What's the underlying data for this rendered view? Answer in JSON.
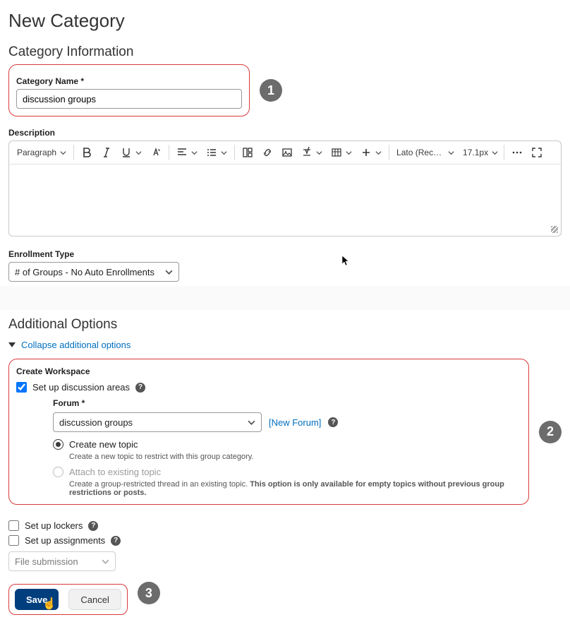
{
  "page": {
    "title": "New Category",
    "section_category_info": "Category Information",
    "section_additional": "Additional Options"
  },
  "category_name": {
    "label": "Category Name *",
    "value": "discussion groups"
  },
  "description": {
    "label": "Description"
  },
  "editor": {
    "paragraph_label": "Paragraph",
    "font_label": "Lato (Recom…",
    "size_label": "17.1px"
  },
  "enrollment": {
    "label": "Enrollment Type",
    "value": "# of Groups - No Auto Enrollments"
  },
  "collapse_link": "Collapse additional options",
  "workspace": {
    "label": "Create Workspace",
    "discussion_checkbox": "Set up discussion areas",
    "forum_label": "Forum *",
    "forum_value": "discussion groups",
    "new_forum_link": "[New Forum]",
    "radio1": {
      "label": "Create new topic",
      "desc": "Create a new topic to restrict with this group category."
    },
    "radio2": {
      "label": "Attach to existing topic",
      "desc1": "Create a group-restricted thread in an existing topic. ",
      "desc2": "This option is only available for empty topics without previous group restrictions or posts."
    }
  },
  "lockers_checkbox": "Set up lockers",
  "assignments_checkbox": "Set up assignments",
  "file_submission": "File submission",
  "buttons": {
    "save": "Save",
    "cancel": "Cancel"
  },
  "callouts": {
    "one": "1",
    "two": "2",
    "three": "3"
  }
}
